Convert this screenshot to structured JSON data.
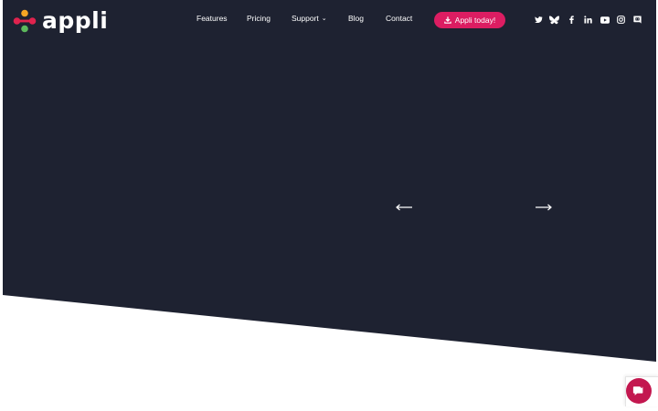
{
  "brand": {
    "name": "appli",
    "logo_colors": [
      "#e0234e",
      "#f5a623",
      "#5cb85c",
      "#3b7dd8"
    ]
  },
  "colors": {
    "hero_bg": "#1e2231",
    "accent": "#dc1d62",
    "chat": "#c3174f"
  },
  "nav": {
    "items": [
      {
        "label": "Features"
      },
      {
        "label": "Pricing"
      },
      {
        "label": "Support",
        "has_dropdown": true
      },
      {
        "label": "Blog"
      },
      {
        "label": "Contact"
      }
    ],
    "cta_label": "Appli today!",
    "cta_icon": "download-icon"
  },
  "social": [
    "twitter-icon",
    "bluesky-icon",
    "facebook-icon",
    "linkedin-icon",
    "youtube-icon",
    "instagram-icon",
    "discord-icon"
  ],
  "slider": {
    "prev_icon": "arrow-left-icon",
    "next_icon": "arrow-right-icon"
  },
  "chat": {
    "icon": "chat-icon"
  }
}
